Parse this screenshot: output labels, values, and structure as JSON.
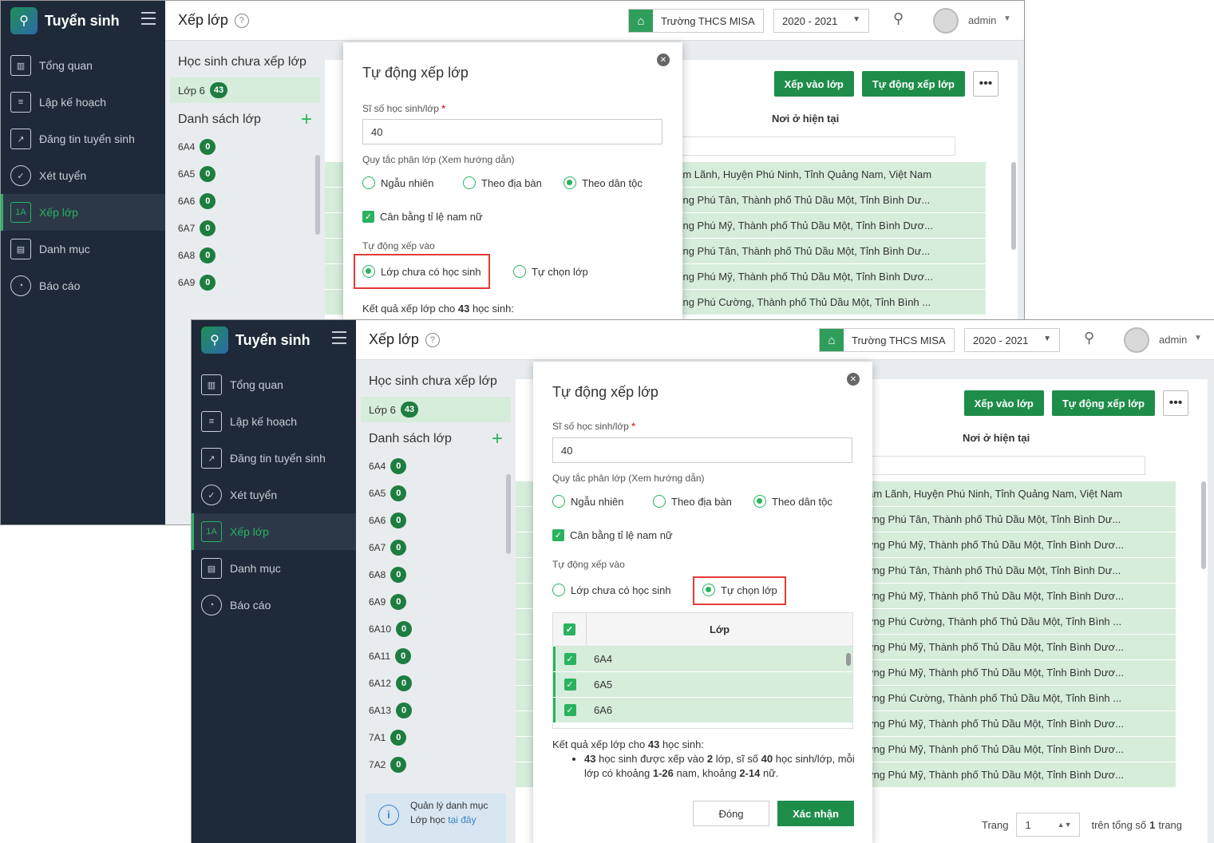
{
  "app": {
    "title": "Tuyển sinh"
  },
  "nav": [
    {
      "label": "Tổng quan"
    },
    {
      "label": "Lập kế hoạch"
    },
    {
      "label": "Đăng tin tuyển sinh"
    },
    {
      "label": "Xét tuyển"
    },
    {
      "label": "Xếp lớp",
      "icon_text": "1A",
      "active": true
    },
    {
      "label": "Danh mục"
    },
    {
      "label": "Báo cáo"
    }
  ],
  "header": {
    "page_title": "Xếp lớp",
    "help_glyph": "?",
    "school": "Trường THCS MISA",
    "year": "2020 - 2021",
    "user": "admin"
  },
  "left_panel": {
    "unassigned_title": "Học sinh chưa xếp lớp",
    "grade_label": "Lớp 6",
    "grade_count": "43",
    "class_list_title": "Danh sách lớp",
    "classes": [
      {
        "name": "6A4",
        "count": "0"
      },
      {
        "name": "6A5",
        "count": "0"
      },
      {
        "name": "6A6",
        "count": "0"
      },
      {
        "name": "6A7",
        "count": "0"
      },
      {
        "name": "6A8",
        "count": "0"
      },
      {
        "name": "6A9",
        "count": "0"
      },
      {
        "name": "6A10",
        "count": "0"
      },
      {
        "name": "6A11",
        "count": "0"
      },
      {
        "name": "6A12",
        "count": "0"
      },
      {
        "name": "6A13",
        "count": "0"
      },
      {
        "name": "7A1",
        "count": "0"
      },
      {
        "name": "7A2",
        "count": "0"
      }
    ],
    "info_text": "Quản lý danh mục Lớp học",
    "info_link": "tại đây"
  },
  "right_panel": {
    "btn_assign": "Xếp vào lớp",
    "btn_auto": "Tự động xếp lớp",
    "btn_more": "•••",
    "col_address": "Nơi ở hiện tại",
    "rows": [
      "ã Tam Lãnh, Huyện Phú Ninh, Tỉnh Quảng Nam, Việt Nam",
      "hường Phú Tân, Thành phố Thủ Dầu Một, Tỉnh Bình Dư...",
      "hường Phú Mỹ, Thành phố Thủ Dầu Một, Tỉnh Bình Dươ...",
      "hường Phú Tân, Thành phố Thủ Dầu Một, Tỉnh Bình Dư...",
      "hường Phú Mỹ, Thành phố Thủ Dầu Một, Tỉnh Bình Dươ...",
      "hường Phú Cường, Thành phố Thủ Dầu Một, Tỉnh Bình ...",
      "hường Phú Mỹ, Thành phố Thủ Dầu Một, Tỉnh Bình Dươ...",
      "hường Phú Mỹ, Thành phố Thủ Dầu Một, Tỉnh Bình Dươ...",
      "hường Phú Cường, Thành phố Thủ Dầu Một, Tỉnh Bình ...",
      "hường Phú Mỹ, Thành phố Thủ Dầu Một, Tỉnh Bình Dươ...",
      "hường Phú Mỹ, Thành phố Thủ Dầu Một, Tỉnh Bình Dươ...",
      "hường Phú Mỹ, Thành phố Thủ Dầu Một, Tỉnh Bình Dươ..."
    ],
    "pager_label": "Trang",
    "pager_value": "1",
    "pager_total_prefix": "trên tổng số",
    "pager_total": "1",
    "pager_total_suffix": "trang"
  },
  "modal": {
    "title": "Tự động xếp lớp",
    "close_glyph": "✕",
    "size_label": "Sĩ số học sinh/lớp",
    "size_required": "*",
    "size_value": "40",
    "rule_label": "Quy tắc phân lớp (Xem hướng dẫn)",
    "rule_random": "Ngẫu nhiên",
    "rule_area": "Theo địa bàn",
    "rule_ethnic": "Theo dân tộc",
    "balance_label": "Cân bằng tỉ lệ nam nữ",
    "auto_into_label": "Tự động xếp vào",
    "opt_empty": "Lớp chưa có học sinh",
    "opt_custom": "Tự chọn lớp",
    "class_col": "Lớp",
    "class_rows": [
      "6A4",
      "6A5",
      "6A6"
    ],
    "result_title_prefix": "Kết quả xếp lớp cho",
    "result_count": "43",
    "result_title_suffix": "học sinh:",
    "result_b1": "43",
    "result_t1": "học sinh được xếp vào",
    "result_b2": "2",
    "result_t2": "lớp, sĩ số",
    "result_b3": "40",
    "result_t3": "học sinh/lớp,",
    "result_t4": "mỗi lớp có khoảng",
    "result_b4": "1-26",
    "result_t5": "nam, khoảng",
    "result_b5": "2-14",
    "result_t6": "nữ.",
    "btn_close": "Đóng",
    "btn_confirm": "Xác nhận"
  }
}
